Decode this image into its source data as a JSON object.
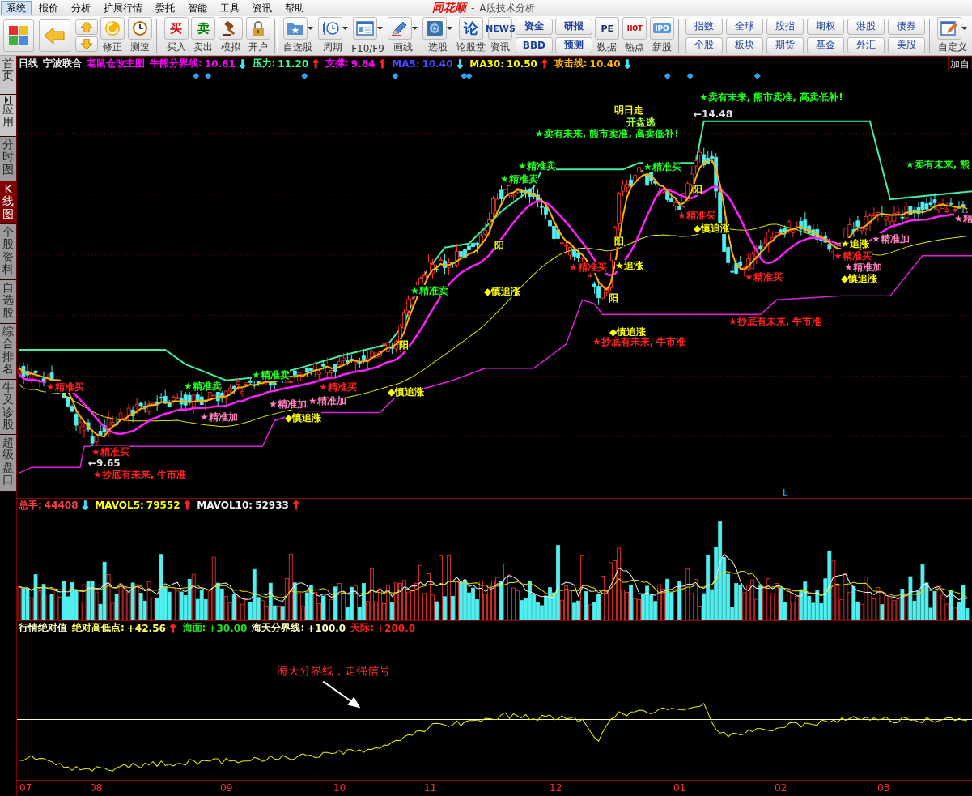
{
  "menu": [
    {
      "label": "系统",
      "selected": true
    },
    {
      "label": "报价",
      "selected": false
    },
    {
      "label": "分析",
      "selected": false
    },
    {
      "label": "扩展行情",
      "selected": false
    },
    {
      "label": "委托",
      "selected": false
    },
    {
      "label": "智能",
      "selected": false
    },
    {
      "label": "工具",
      "selected": false
    },
    {
      "label": "资讯",
      "selected": false
    },
    {
      "label": "帮助",
      "selected": false
    }
  ],
  "title": {
    "logo": "同花顺",
    "separator": "-",
    "text": "A股技术分析"
  },
  "toolbar": [
    {
      "kind": "big"
    },
    {
      "kind": "big"
    },
    {
      "kind": "updown"
    },
    {
      "kind": "icon",
      "label": "修正"
    },
    {
      "kind": "icon",
      "label": "测速"
    },
    {
      "kind": "sep"
    },
    {
      "kind": "icon",
      "label": "买入",
      "icon_text": "买"
    },
    {
      "kind": "icon",
      "label": "卖出",
      "icon_text": "卖"
    },
    {
      "kind": "icon",
      "label": "模拟"
    },
    {
      "kind": "icon",
      "label": "开户"
    },
    {
      "kind": "sep"
    },
    {
      "kind": "dropdown",
      "label": "自选股"
    },
    {
      "kind": "dropdown",
      "label": "周期"
    },
    {
      "kind": "dropdown",
      "label": "F10/F9"
    },
    {
      "kind": "dropdown",
      "label": "画线"
    },
    {
      "kind": "dropdown",
      "label": "选股"
    },
    {
      "kind": "icon",
      "label": "论股堂",
      "icon_text": "论"
    },
    {
      "kind": "icon",
      "label": "资讯",
      "icon_text": "NEWS"
    },
    {
      "kind": "pair",
      "buttons": [
        "资金",
        "BBD"
      ]
    },
    {
      "kind": "pair",
      "buttons": [
        "研报",
        "预测"
      ]
    },
    {
      "kind": "icon",
      "label": "数据",
      "icon_text": "PE"
    },
    {
      "kind": "icon",
      "label": "热点",
      "icon_text": "HOT"
    },
    {
      "kind": "icon",
      "label": "新股",
      "icon_text": "IPO"
    },
    {
      "kind": "sep"
    },
    {
      "kind": "grid",
      "buttons": [
        "指数",
        "全球",
        "股指",
        "期权",
        "港股",
        "债券",
        "个股",
        "板块",
        "期货",
        "基金",
        "外汇",
        "美股"
      ]
    },
    {
      "kind": "sep"
    },
    {
      "kind": "dropdown",
      "label": "自定义"
    }
  ],
  "sidebar": [
    {
      "label": "首页",
      "selected": false
    },
    {
      "label": "应用",
      "selected": false
    },
    {
      "label": "分时图",
      "selected": false
    },
    {
      "label": "K线图",
      "selected": true
    },
    {
      "label": "个股资料",
      "selected": false
    },
    {
      "label": "自选股",
      "selected": false
    },
    {
      "label": "综合排名",
      "selected": false
    },
    {
      "label": "牛叉诊股",
      "selected": false
    },
    {
      "label": "超级盘口",
      "selected": false
    }
  ],
  "chart_header": {
    "period": "日线",
    "stock": "宁波联合",
    "formula": "老鼠仓改主图",
    "indicators": [
      {
        "label": "牛熊分界线:",
        "value": "10.61",
        "arrow": {
          "text": "↓",
          "color": "#40e0ff"
        },
        "color": "#ff00ff"
      },
      {
        "label": "压力:",
        "value": "11.20",
        "arrow": {
          "text": "↑",
          "color": "#ff2020"
        },
        "color": "#40ff90"
      },
      {
        "label": "支撑:",
        "value": "9.84",
        "arrow": {
          "text": "↑",
          "color": "#ff2020"
        },
        "color": "#ff00ff"
      },
      {
        "label": "MA5:",
        "value": "10.40",
        "arrow": {
          "text": "↓",
          "color": "#40e0ff"
        },
        "color": "#4848ff"
      },
      {
        "label": "MA30:",
        "value": "10.50",
        "arrow": {
          "text": "↑",
          "color": "#ff2020"
        },
        "color": "#ffff00"
      },
      {
        "label": "攻击线:",
        "value": "10.40",
        "arrow": {
          "text": "↓",
          "color": "#40e0ff"
        },
        "color": "#ffb000"
      }
    ],
    "button": "加自"
  },
  "signals": [
    {
      "text": "★卖有未来, 熊市卖准, 高卖低补!",
      "color": "#20ff20"
    },
    {
      "text": "明日走",
      "color": "#ffff00"
    },
    {
      "text": "←14.48",
      "color": "#e0e0e0"
    },
    {
      "text": "开盘逃",
      "color": "#a0ff40"
    },
    {
      "text": "★卖有未来, 熊市卖准, 高卖低补!",
      "color": "#20ff20"
    },
    {
      "text": "★精准卖",
      "color": "#20ff20"
    },
    {
      "text": "★精准买",
      "color": "#20ff20"
    },
    {
      "text": "★卖有未来, 熊",
      "color": "#20ff20"
    },
    {
      "text": "★精准卖",
      "color": "#20ff20"
    },
    {
      "text": "阳",
      "color": "#ffff00"
    },
    {
      "text": "★精准买",
      "color": "#ff2020"
    },
    {
      "text": "★精",
      "color": "#ff80c0"
    },
    {
      "text": "◆慎追涨",
      "color": "#ffff00"
    },
    {
      "text": "阳",
      "color": "#ffff00"
    },
    {
      "text": "阳",
      "color": "#ffff00"
    },
    {
      "text": "★追涨",
      "color": "#ffff00"
    },
    {
      "text": "★精准加",
      "color": "#ff80c0"
    },
    {
      "text": "★精准买",
      "color": "#ff2020"
    },
    {
      "text": "★精准买",
      "color": "#ff2020"
    },
    {
      "text": "★追涨",
      "color": "#ffff00"
    },
    {
      "text": "★精准加",
      "color": "#ff80c0"
    },
    {
      "text": "★精准买",
      "color": "#ff2020"
    },
    {
      "text": "◆慎追涨",
      "color": "#ffff00"
    },
    {
      "text": "★精准卖",
      "color": "#20ff20"
    },
    {
      "text": "◆慎追涨",
      "color": "#ffff00"
    },
    {
      "text": "阳",
      "color": "#ffff00"
    },
    {
      "text": "★抄底有未来, 牛市准",
      "color": "#ff2020"
    },
    {
      "text": "◆慎追涨",
      "color": "#ffff00"
    },
    {
      "text": "阳",
      "color": "#ffff00"
    },
    {
      "text": "★抄底有未来, 牛市准",
      "color": "#ff2020"
    },
    {
      "text": "★精准卖",
      "color": "#20ff20"
    },
    {
      "text": "★精准买",
      "color": "#ff2020"
    },
    {
      "text": "★精准卖",
      "color": "#20ff20"
    },
    {
      "text": "★精准买",
      "color": "#ff2020"
    },
    {
      "text": "◆慎追涨",
      "color": "#ffff00"
    },
    {
      "text": "★精准加",
      "color": "#ff80c0"
    },
    {
      "text": "★精准加",
      "color": "#ff80c0"
    },
    {
      "text": "★精准加",
      "color": "#ff80c0"
    },
    {
      "text": "◆慎追涨",
      "color": "#ffff00"
    },
    {
      "text": "★精准买",
      "color": "#ff2020"
    },
    {
      "text": "←9.65",
      "color": "#e0e0e0"
    },
    {
      "text": "★抄底有未来, 牛市准",
      "color": "#ff2020"
    },
    {
      "text": "L",
      "color": "#00b0ff"
    }
  ],
  "volume_header": [
    {
      "label": "总手:",
      "value": "44408",
      "arrow": {
        "text": "↓",
        "color": "#40e0ff"
      },
      "color": "#ff4040"
    },
    {
      "label": "MAVOL5:",
      "value": "79552",
      "arrow": {
        "text": "↑",
        "color": "#ff2020"
      },
      "color": "#ffff00"
    },
    {
      "label": "MAVOL10:",
      "value": "52933",
      "arrow": {
        "text": "↑",
        "color": "#ff2020"
      },
      "color": "#f0f0f0"
    }
  ],
  "indicator_header": {
    "title": "行情绝对值",
    "items": [
      {
        "label": "绝对高低点:",
        "value": "+42.56",
        "arrow": {
          "text": "↑",
          "color": "#ff2020"
        },
        "color": "#ffff60"
      },
      {
        "label": "海面:",
        "value": "+30.00",
        "color": "#20e020"
      },
      {
        "label": "海天分界线:",
        "value": "+100.0",
        "color": "#ffffc0"
      },
      {
        "label": "天际:",
        "value": "+200.0",
        "color": "#ff2020"
      }
    ]
  },
  "indicator_note": "海天分界线，走强信号",
  "months": [
    "07",
    "08",
    "09",
    "10",
    "11",
    "12",
    "01",
    "02",
    "03"
  ]
}
